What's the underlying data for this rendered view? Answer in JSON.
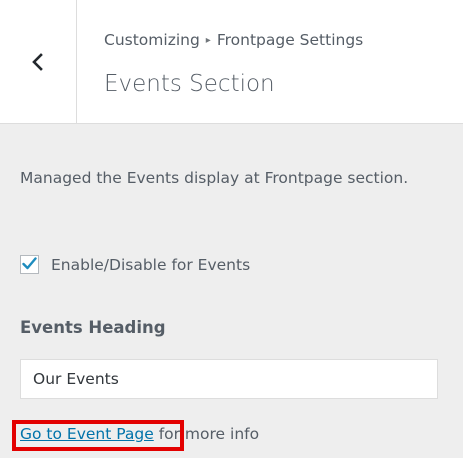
{
  "header": {
    "breadcrumb_parent": "Customizing",
    "breadcrumb_separator": "▸",
    "breadcrumb_current": "Frontpage Settings",
    "title": "Events Section",
    "back_icon": "chevron-left-icon"
  },
  "section": {
    "description": "Managed the Events display at Frontpage section.",
    "enable_checkbox": {
      "label": "Enable/Disable for Events",
      "checked": true
    },
    "heading_field": {
      "label": "Events Heading",
      "value": "Our Events"
    },
    "info": {
      "link_text": "Go to Event Page",
      "suffix": " for more info"
    }
  },
  "colors": {
    "link": "#0073aa",
    "check": "#1e8cbe",
    "highlight_box": "#e30000"
  }
}
